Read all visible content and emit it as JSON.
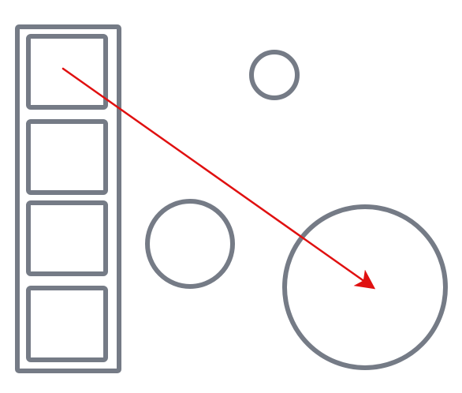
{
  "colors": {
    "background": "#ffffff",
    "outline": "#757b86",
    "arrow": "#e01010"
  },
  "diagram": {
    "container": {
      "kind": "column-of-boxes",
      "box_count": 4
    },
    "circles": [
      "small-top",
      "medium-left",
      "large-right"
    ],
    "arrow": {
      "from": "box-1-center",
      "to": "large-circle-center"
    }
  }
}
